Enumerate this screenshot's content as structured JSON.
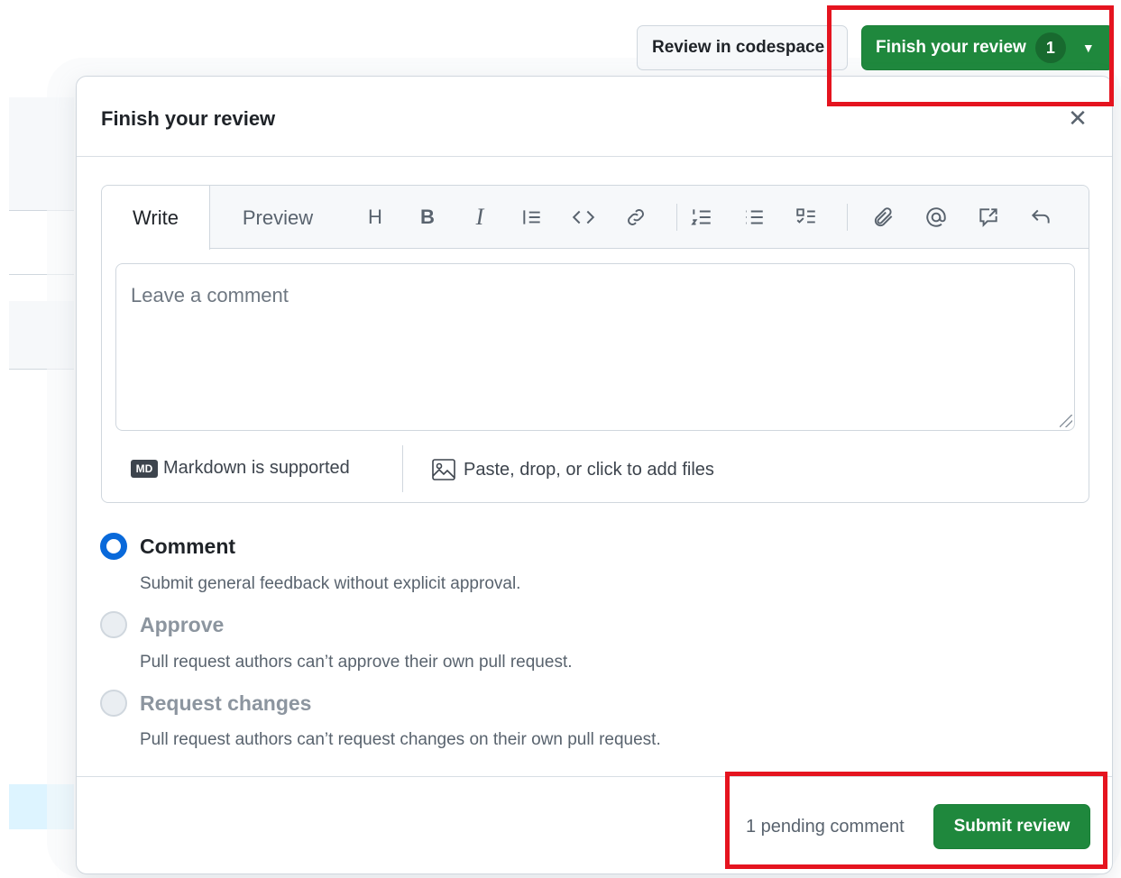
{
  "header": {
    "codespace_label": "Review in codespace",
    "finish_label": "Finish your review",
    "finish_count": "1"
  },
  "dialog": {
    "title": "Finish your review",
    "close_icon": "close-icon"
  },
  "editor": {
    "tabs": [
      {
        "label": "Write",
        "active": true
      },
      {
        "label": "Preview",
        "active": false
      }
    ],
    "toolbar": {
      "heading": "H",
      "bold": "B",
      "italic": "I",
      "icons": [
        "heading-icon",
        "bold-icon",
        "italic-icon",
        "quote-icon",
        "code-icon",
        "link-icon",
        "ordered-list-icon",
        "unordered-list-icon",
        "task-list-icon",
        "attach-icon",
        "mention-icon",
        "reference-icon",
        "undo-icon"
      ]
    },
    "placeholder": "Leave a comment",
    "markdown_hint": "Markdown is supported",
    "markdown_badge": "MD",
    "file_hint": "Paste, drop, or click to add files"
  },
  "review_options": [
    {
      "label": "Comment",
      "description": "Submit general feedback without explicit approval.",
      "checked": true,
      "disabled": false
    },
    {
      "label": "Approve",
      "description": "Pull request authors can’t approve their own pull request.",
      "checked": false,
      "disabled": true
    },
    {
      "label": "Request changes",
      "description": "Pull request authors can’t request changes on their own pull request.",
      "checked": false,
      "disabled": true
    }
  ],
  "footer": {
    "pending": "1 pending comment",
    "submit_label": "Submit review"
  },
  "colors": {
    "primary_green": "#1f883d",
    "accent_blue": "#0969da",
    "annotation_red": "#e5141f"
  }
}
